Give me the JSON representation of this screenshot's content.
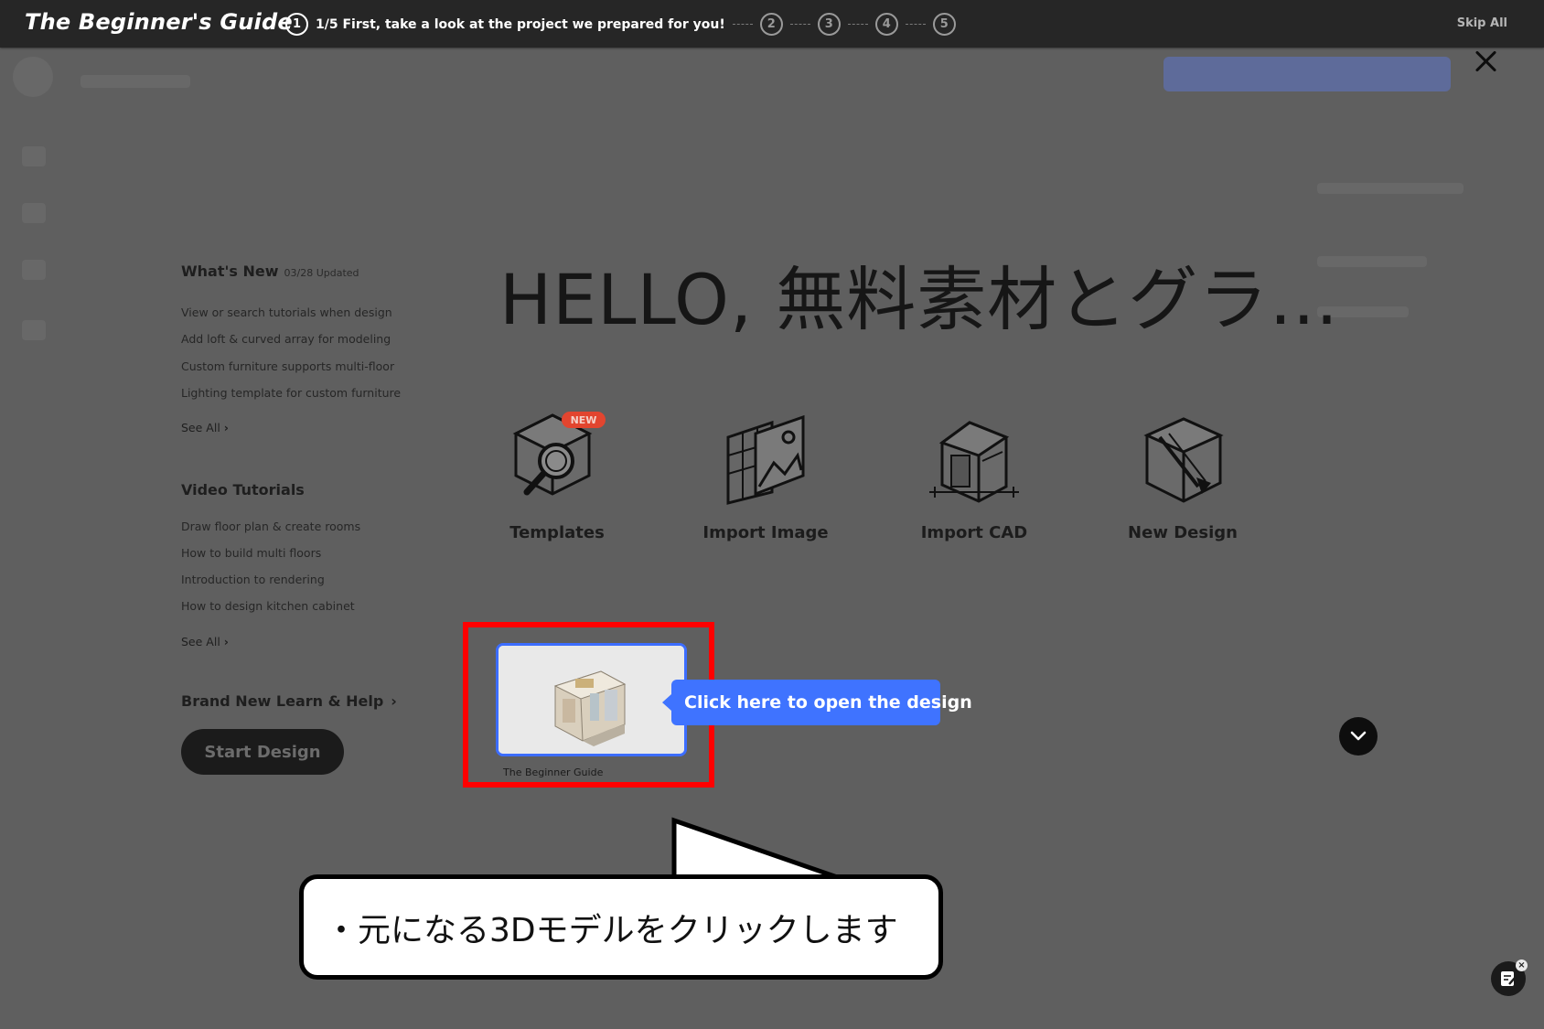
{
  "guide": {
    "title": "The Beginner's Guide",
    "current_step": "1",
    "step_text": "1/5 First, take a look at the project we prepared for you!",
    "steps": [
      "2",
      "3",
      "4",
      "5"
    ],
    "skip_label": "Skip All"
  },
  "whats_new": {
    "title": "What's New",
    "updated": "03/28 Updated",
    "items": [
      "View or search tutorials when design",
      "Add loft & curved array for modeling",
      "Custom furniture supports multi-floor",
      "Lighting template for custom furniture"
    ],
    "see_all": "See All"
  },
  "video_tutorials": {
    "title": "Video Tutorials",
    "items": [
      "Draw floor plan & create rooms",
      "How to build multi floors",
      "Introduction to rendering",
      "How to design kitchen cabinet"
    ],
    "see_all": "See All"
  },
  "learn_help": {
    "label": "Brand New Learn & Help"
  },
  "start_design": {
    "label": "Start Design"
  },
  "hello": {
    "text": "HELLO, 無料素材とグラ…"
  },
  "actions": [
    {
      "label": "Templates",
      "icon": "templates-icon",
      "badge": "NEW"
    },
    {
      "label": "Import Image",
      "icon": "import-image-icon"
    },
    {
      "label": "Import CAD",
      "icon": "import-cad-icon"
    },
    {
      "label": "New Design",
      "icon": "new-design-icon"
    }
  ],
  "design_card": {
    "caption": "The Beginner Guide",
    "tooltip": "Click here to open the design"
  },
  "annotation": {
    "text": "・元になる3Dモデルをクリックします"
  },
  "colors": {
    "accent_blue": "#3f73ff",
    "highlight_red": "#ff0000",
    "badge_red": "#e2452f",
    "topbar": "#262626",
    "overlay": "#5f5f5f"
  }
}
